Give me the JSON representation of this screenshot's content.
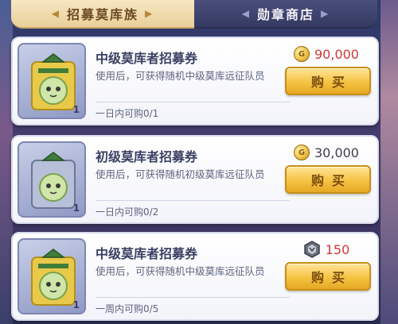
{
  "tabs": [
    {
      "label": "招募莫库族"
    },
    {
      "label": "勋章商店"
    }
  ],
  "items": [
    {
      "name": "中级莫库者招募券",
      "desc": "使用后，可获得随机中级莫库远征队员",
      "limit": "一日内可购0/1",
      "count": "1",
      "currency_icon": "gold-coin-icon",
      "price": "90,000",
      "price_color": "#d23838",
      "buy_label": "购买",
      "icon": "mid-recruit-ticket-icon"
    },
    {
      "name": "初级莫库者招募券",
      "desc": "使用后，可获得随机初级莫库远征队员",
      "limit": "一日内可购0/2",
      "count": "1",
      "currency_icon": "gold-coin-icon",
      "price": "30,000",
      "price_color": "#3e3e4e",
      "buy_label": "购买",
      "icon": "basic-recruit-ticket-icon"
    },
    {
      "name": "中级莫库者招募券",
      "desc": "使用后，可获得随机中级莫库远征队员",
      "limit": "一周内可购0/5",
      "count": "1",
      "currency_icon": "medal-icon",
      "price": "150",
      "price_color": "#d23838",
      "buy_label": "购买",
      "icon": "mid-recruit-ticket-icon"
    }
  ],
  "colors": {
    "tab_active_bg": "#f6e7c2",
    "tab_inactive_bg": "#4a4f7a",
    "buy_button": "#f5c343",
    "price_red": "#d23838"
  }
}
